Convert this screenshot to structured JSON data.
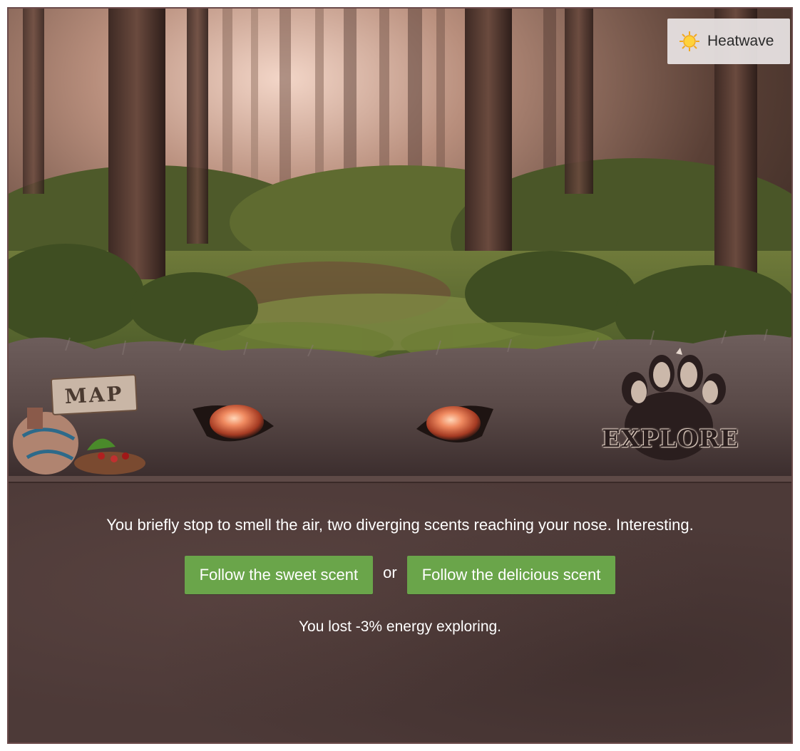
{
  "weather": {
    "label": "Heatwave",
    "icon": "sun-icon"
  },
  "scene": {
    "map_label": "MAP",
    "explore_label": "EXPLORE",
    "background": "forest",
    "creature": "wolf-eyes"
  },
  "message": "You briefly stop to smell the air, two diverging scents reaching your nose. Interesting.",
  "choices": [
    {
      "label": "Follow the sweet scent"
    },
    {
      "label": "Follow the delicious scent"
    }
  ],
  "separator": "or",
  "energy_text": "You lost -3% energy exploring.",
  "colors": {
    "button": "#6aa54a",
    "panel": "#4d3a38",
    "border": "#6a4a4a"
  }
}
